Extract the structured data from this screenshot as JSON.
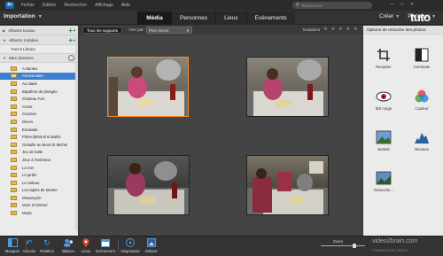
{
  "menubar": {
    "logo": "Pr",
    "items": [
      "Fichier",
      "Edition",
      "Rechercher",
      "Affichage",
      "Aide"
    ],
    "search_placeholder": "Rechercher",
    "window_controls": "— □ ✕"
  },
  "topbar": {
    "import_label": "Importation",
    "tabs": [
      "Média",
      "Personnes",
      "Lieux",
      "Evénements"
    ],
    "active_tab": "Média",
    "create_label": "Créer",
    "share_label": "Partager",
    "brand": "tuto"
  },
  "leftpanel": {
    "albums_local": "Albums locaux",
    "albums_mobile": "Albums mobiles",
    "library": "Yves's Library",
    "my_folders": "Mes dossiers",
    "folders": [
      "A Nantes",
      "Anniversaire",
      "Au stade",
      "Baptême de plongée",
      "Chateau Fort",
      "Corse",
      "Courses",
      "Divers",
      "Escalade",
      "Fêtes (Bérénil et Balin)",
      "Grisaille au Mont St Michel",
      "Jeu de balle",
      "Jeux à l'extérieur",
      "La mer",
      "Le jardin",
      "Le radeau",
      "Les tapins de Mamie",
      "Mosaïcycle",
      "Mont St Michel",
      "Music"
    ],
    "selected_folder": 1
  },
  "contentbar": {
    "all_media": "Tous les supports",
    "sort_label": "Trier par :",
    "sort_value": "Plus récent",
    "rating_label": "Notations",
    "stars": "★ ★ ★ ★ ★"
  },
  "rightpanel": {
    "title": "Options de retouche des photos",
    "tools": [
      "Recadrer",
      "Contraste",
      "Œil rouge",
      "Couleur",
      "Netteté",
      "Niveaux",
      "Retouche..."
    ]
  },
  "bottombar": {
    "items": [
      "Masquer",
      "Annuler",
      "Rotation",
      "Balises",
      "Lieux",
      "Evénement",
      "Diaporama",
      "Editeur"
    ],
    "zoom_label": "Zoom",
    "zoom_level": 0.75,
    "watermark": "video2brain.com",
    "watermark_sub": "FORMATIONS VIDÉO"
  }
}
